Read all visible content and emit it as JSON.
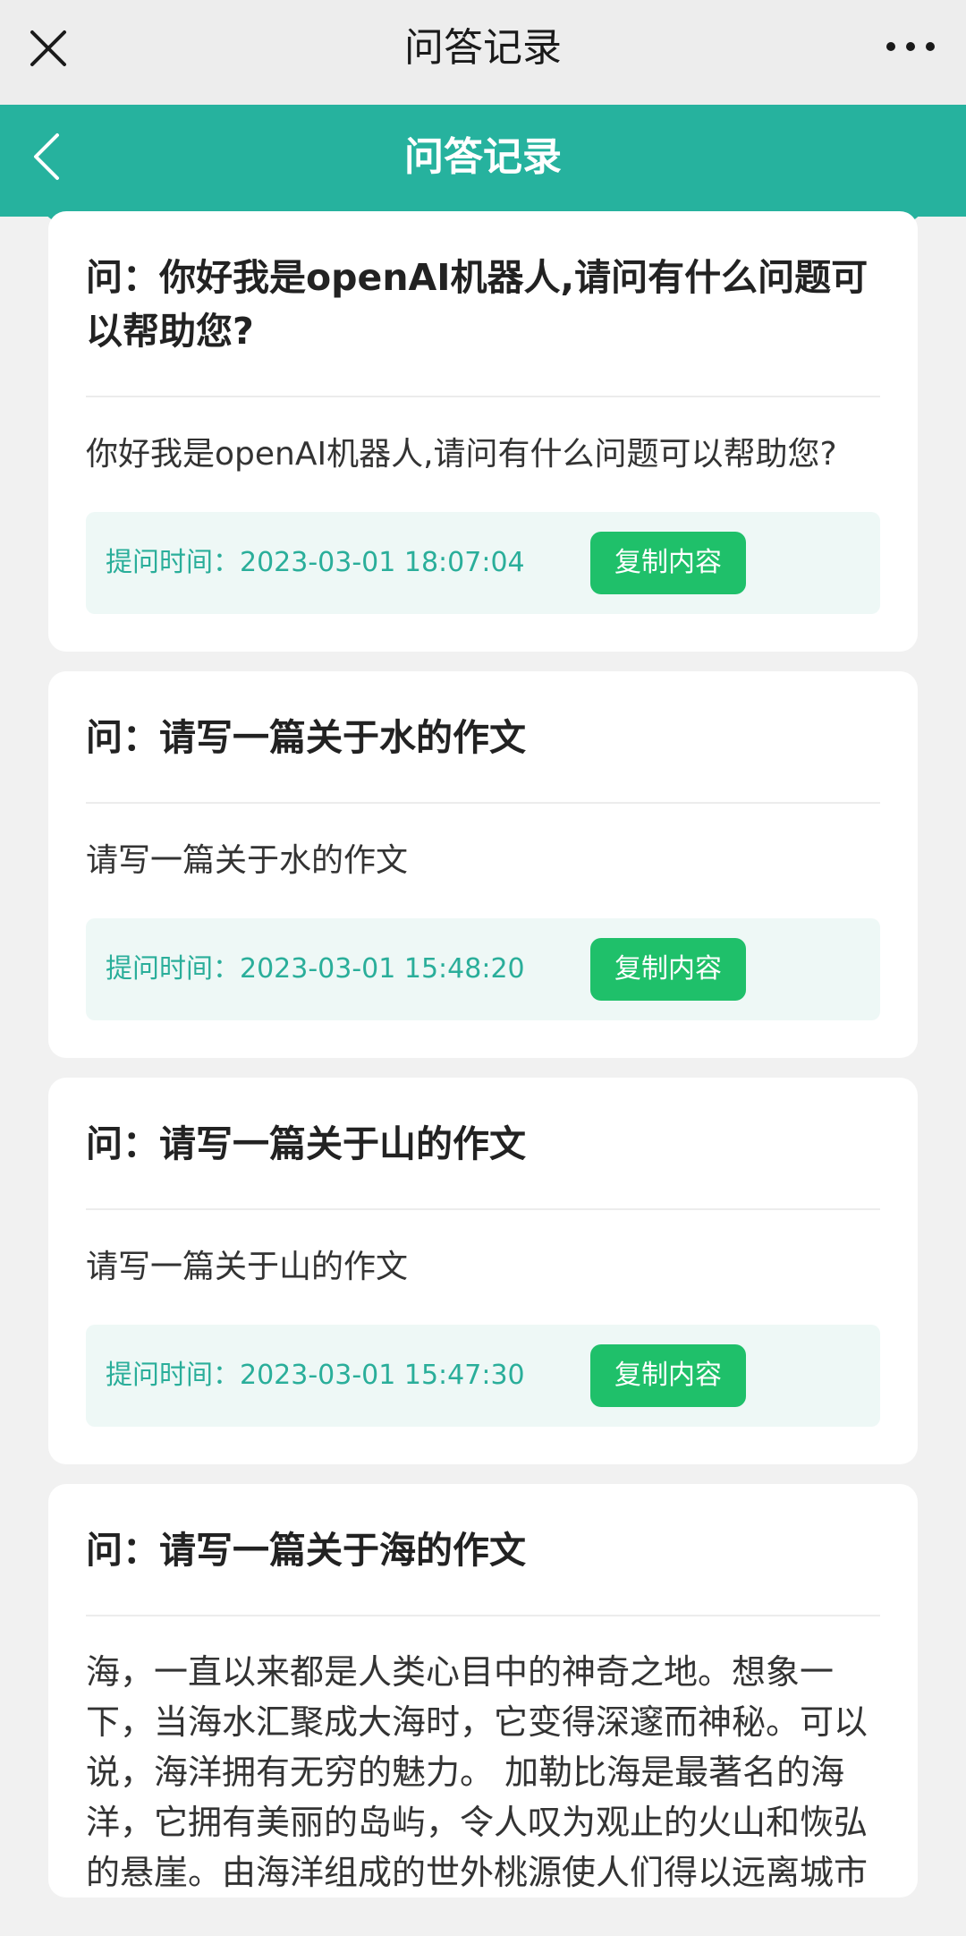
{
  "window": {
    "title": "问答记录"
  },
  "header": {
    "title": "问答记录"
  },
  "colors": {
    "accent": "#26b29e",
    "copy_button": "#1fc06a",
    "time_text": "#2aae9a"
  },
  "records": [
    {
      "question": "问：你好我是openAI机器人,请问有什么问题可以帮助您?",
      "answer": "你好我是openAI机器人,请问有什么问题可以帮助您?",
      "time": "提问时间：2023-03-01 18:07:04",
      "copy_label": "复制内容"
    },
    {
      "question": "问：请写一篇关于水的作文",
      "answer": "请写一篇关于水的作文",
      "time": "提问时间：2023-03-01 15:48:20",
      "copy_label": "复制内容"
    },
    {
      "question": "问：请写一篇关于山的作文",
      "answer": "请写一篇关于山的作文",
      "time": "提问时间：2023-03-01 15:47:30",
      "copy_label": "复制内容"
    },
    {
      "question": "问：请写一篇关于海的作文",
      "answer": "海，一直以来都是人类心目中的神奇之地。想象一下，当海水汇聚成大海时，它变得深邃而神秘。可以说，海洋拥有无穷的魅力。 加勒比海是最著名的海洋，它拥有美丽的岛屿，令人叹为观止的火山和恢弘的悬崖。由海洋组成的世外桃源使人们得以远离城市"
    }
  ]
}
